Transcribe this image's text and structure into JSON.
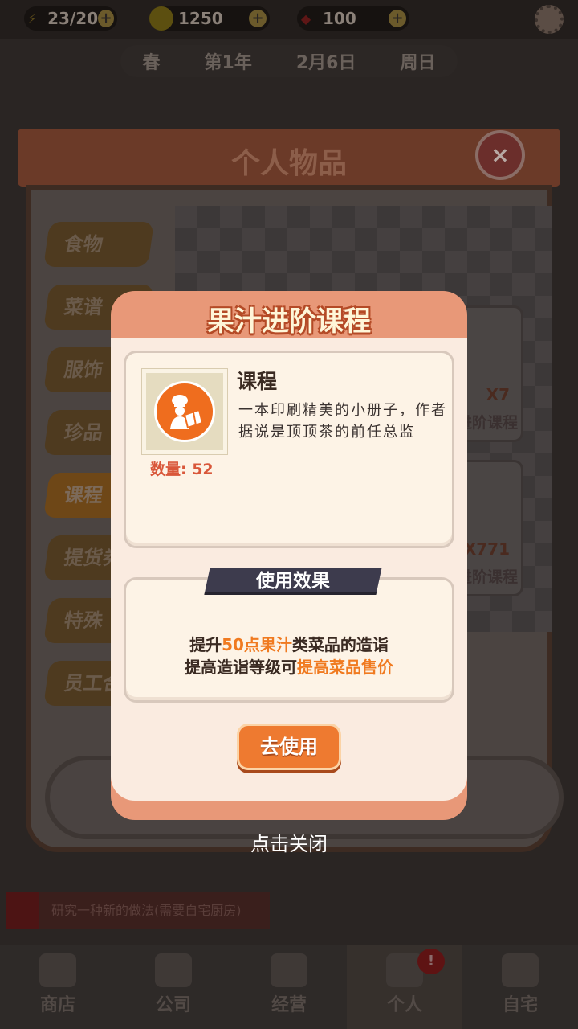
{
  "topbar": {
    "energy": "23/20",
    "gold": "1250",
    "gems": "100",
    "plus": "+"
  },
  "datebar": {
    "season": "春",
    "year": "第1年",
    "date": "2月6日",
    "weekday": "周日"
  },
  "panel": {
    "title": "个人物品",
    "close": "×",
    "tabs": [
      "食物",
      "菜谱",
      "服饰",
      "珍品",
      "课程",
      "提货券",
      "特殊",
      "员工合"
    ],
    "cards": [
      {
        "qty": "X7",
        "name": "进阶课程"
      },
      {
        "qty": "X771",
        "name": "进阶课程"
      }
    ]
  },
  "hint": "研究一种新的做法(需要自宅厨房)",
  "bottomnav": {
    "items": [
      "商店",
      "公司",
      "经营",
      "个人",
      "自宅"
    ],
    "badge": "!"
  },
  "dialog": {
    "title": "果汁进阶课程",
    "item_name": "课程",
    "quantity": "数量: 52",
    "description": "一本印刷精美的小册子，作者据说是顶顶茶的前任总监",
    "effect_label": "使用效果",
    "effect_line1": {
      "pre": "提升",
      "hl": "50点果汁",
      "post": "类菜品的造诣"
    },
    "effect_line2": {
      "pre": "提高造诣等级可",
      "hl": "提高菜品售价",
      "post": ""
    },
    "use_button": "去使用"
  },
  "tap_to_close": "点击关闭",
  "colors": {
    "accent_orange": "#ef6d1e",
    "dialog_header": "#e89878",
    "highlight": "#f07a20"
  }
}
